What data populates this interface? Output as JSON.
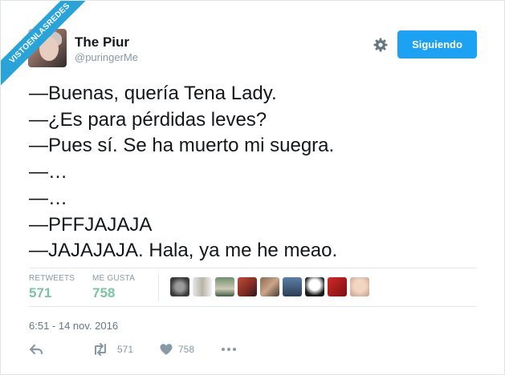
{
  "watermark": "VISTOENLASREDES",
  "header": {
    "display_name": "The Piur",
    "handle": "@puringerMe",
    "follow_button_label": "Siguiendo"
  },
  "icons": {
    "settings": "gear-icon",
    "reply": "reply-arrow-icon",
    "retweet": "retweet-icon",
    "like": "heart-icon",
    "more": "more-dots-icon"
  },
  "tweet": {
    "lines": [
      "—Buenas, quería Tena Lady.",
      "—¿Es para pérdidas leves?",
      "—Pues sí. Se ha muerto mi suegra.",
      "—…",
      "—…",
      "—PFFJAJAJA",
      "—JAJAJAJA. Hala, ya me he meao."
    ]
  },
  "stats": {
    "retweets_label": "RETWEETS",
    "retweets_value": "571",
    "likes_label": "ME GUSTA",
    "likes_value": "758"
  },
  "likers_count_shown": 9,
  "timestamp": "6:51 - 14 nov. 2016",
  "actions": {
    "retweet_count": "571",
    "like_count": "758"
  },
  "colors": {
    "accent": "#1da1f2",
    "stat_value": "#7ac4a2",
    "ribbon": "#2aa3d8"
  }
}
